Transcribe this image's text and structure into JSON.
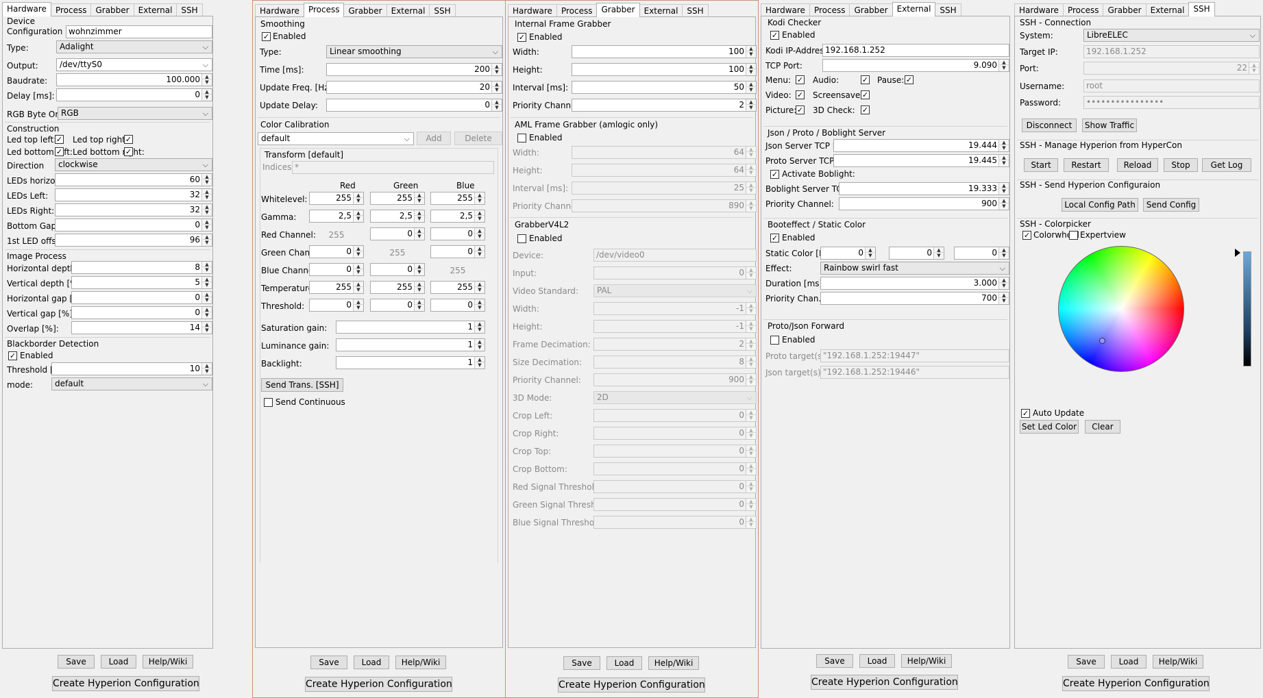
{
  "common": {
    "tabs": [
      "Hardware",
      "Process",
      "Grabber",
      "External",
      "SSH"
    ],
    "save": "Save",
    "load": "Load",
    "help": "Help/Wiki",
    "create": "Create Hyperion Configuration"
  },
  "hw": {
    "device_title": "Device",
    "config_name_label": "Configuration name:",
    "config_name": "wohnzimmer",
    "type_label": "Type:",
    "type": "Adalight",
    "output_label": "Output:",
    "output": "/dev/ttyS0",
    "baud_label": "Baudrate:",
    "baud": "100.000",
    "delay_label": "Delay [ms]:",
    "delay": "0",
    "rgb_label": "RGB Byte Order:",
    "rgb": "RGB",
    "construction_title": "Construction",
    "led_top_left": "Led top left:",
    "led_top_right": "Led top right:",
    "led_bottom_left": "Led bottom left:",
    "led_bottom_right": "Led bottom right:",
    "direction_label": "Direction",
    "direction": "clockwise",
    "leds_h_label": "LEDs horizontal:",
    "leds_h": "60",
    "leds_l_label": "LEDs Left:",
    "leds_l": "32",
    "leds_r_label": "LEDs Right:",
    "leds_r": "32",
    "bottom_gap_label": "Bottom Gap:",
    "bottom_gap": "0",
    "first_led_label": "1st LED offset",
    "first_led": "96",
    "image_title": "Image Process",
    "hdepth_label": "Horizontal depth [%]:",
    "hdepth": "8",
    "vdepth_label": "Vertical depth [%]:",
    "vdepth": "5",
    "hgap_label": "Horizontal gap [%]:",
    "hgap": "0",
    "vgap_label": "Vertical gap [%]:",
    "vgap": "0",
    "overlap_label": "Overlap [%]:",
    "overlap": "14",
    "bb_title": "Blackborder Detection",
    "enabled": "Enabled",
    "threshold_label": "Threshold [%]:",
    "threshold": "10",
    "mode_label": "mode:",
    "mode": "default"
  },
  "proc": {
    "smoothing_title": "Smoothing",
    "enabled": "Enabled",
    "type_label": "Type:",
    "type": "Linear smoothing",
    "time_label": "Time [ms]:",
    "time": "200",
    "freq_label": "Update Freq. [Hz]:",
    "freq": "20",
    "delay_label": "Update Delay:",
    "delay": "0",
    "color_title": "Color Calibration",
    "profile": "default",
    "add": "Add",
    "delete": "Delete",
    "transform_title": "Transform [default]",
    "indices_label": "Indices:",
    "indices": "*",
    "col_red": "Red",
    "col_green": "Green",
    "col_blue": "Blue",
    "rows": [
      {
        "label": "Whitelevel:",
        "r": "255",
        "g": "255",
        "b": "255"
      },
      {
        "label": "Gamma:",
        "r": "2,5",
        "g": "2,5",
        "b": "2,5"
      },
      {
        "label": "Red Channel:",
        "r": "255",
        "g": "0",
        "b": "0"
      },
      {
        "label": "Green Channel:",
        "r": "0",
        "g": "255",
        "b": "0"
      },
      {
        "label": "Blue Channel:",
        "r": "0",
        "g": "0",
        "b": "255"
      },
      {
        "label": "Temperature:",
        "r": "255",
        "g": "255",
        "b": "255"
      },
      {
        "label": "Threshold:",
        "r": "0",
        "g": "0",
        "b": "0"
      }
    ],
    "sat_label": "Saturation gain:",
    "sat": "1",
    "lum_label": "Luminance gain:",
    "lum": "1",
    "back_label": "Backlight:",
    "back": "1",
    "send_trans": "Send Trans. [SSH]",
    "send_cont": "Send Continuous"
  },
  "grab": {
    "int_title": "Internal Frame Grabber",
    "enabled": "Enabled",
    "width_label": "Width:",
    "width": "100",
    "height_label": "Height:",
    "height": "100",
    "interval_label": "Interval [ms]:",
    "interval": "50",
    "prio_label": "Priority Channel:",
    "prio": "2",
    "aml_title": "AML Frame Grabber (amlogic only)",
    "aml_width": "64",
    "aml_height": "64",
    "aml_interval": "25",
    "aml_prio": "890",
    "v4l_title": "GrabberV4L2",
    "device_label": "Device:",
    "device": "/dev/video0",
    "input_label": "Input:",
    "input": "0",
    "std_label": "Video Standard:",
    "std": "PAL",
    "v_width": "-1",
    "v_height": "-1",
    "frame_dec_label": "Frame Decimation:",
    "frame_dec": "2",
    "size_dec_label": "Size Decimation:",
    "size_dec": "8",
    "v_prio": "900",
    "mode3d_label": "3D Mode:",
    "mode3d": "2D",
    "crop_left_label": "Crop Left:",
    "crop_right_label": "Crop Right:",
    "crop_top_label": "Crop Top:",
    "crop_bottom_label": "Crop Bottom:",
    "red_thr_label": "Red Signal Threshold:",
    "green_thr_label": "Green Signal Threshold:",
    "blue_thr_label": "Blue Signal Threshold:",
    "zero": "0"
  },
  "ext": {
    "kodi_title": "Kodi Checker",
    "enabled": "Enabled",
    "ip_label": "Kodi IP-Address:",
    "ip": "192.168.1.252",
    "port_label": "TCP Port:",
    "port": "9.090",
    "menu": "Menu:",
    "audio": "Audio:",
    "pause": "Pause:",
    "video": "Video:",
    "screensaver": "Screensaver:",
    "picture": "Picture:",
    "check3d": "3D Check:",
    "server_title": "Json / Proto / Boblight Server",
    "json_label": "Json Server TCP Port:",
    "json": "19.444",
    "proto_label": "Proto Server TCP Port:",
    "proto": "19.445",
    "boblight_act": "Activate Boblight:",
    "boblight_label": "Boblight Server TCP Port:",
    "boblight": "19.333",
    "prio_label": "Priority Channel:",
    "prio": "900",
    "boot_title": "Booteffect / Static Color",
    "static_label": "Static Color [RGB]:",
    "static_r": "0",
    "static_g": "0",
    "static_b": "0",
    "effect_label": "Effect:",
    "effect": "Rainbow swirl fast",
    "duration_label": "Duration [ms]:",
    "duration": "3.000",
    "prio_chan_label": "Priority Chan.:",
    "prio_chan": "700",
    "fwd_title": "Proto/Json Forward",
    "proto_target_label": "Proto target(s):",
    "proto_target": "\"192.168.1.252:19447\"",
    "json_target_label": "Json target(s):",
    "json_target": "\"192.168.1.252:19446\""
  },
  "ssh": {
    "conn_title": "SSH - Connection",
    "system_label": "System:",
    "system": "LibreELEC",
    "target_label": "Target IP:",
    "target": "192.168.1.252",
    "port_label": "Port:",
    "port": "22",
    "user_label": "Username:",
    "user": "root",
    "pass_label": "Password:",
    "pass": "••••••••••••••••",
    "disconnect": "Disconnect",
    "traffic": "Show Traffic",
    "manage_title": "SSH - Manage Hyperion from HyperCon",
    "start": "Start",
    "restart": "Restart",
    "reload": "Reload",
    "stop": "Stop",
    "getlog": "Get Log",
    "send_title": "SSH - Send Hyperion Configuraion",
    "local_path": "Local Config Path",
    "send_config": "Send Config",
    "picker_title": "SSH - Colorpicker",
    "colorwheel": "Colorwheel",
    "expertview": "Expertview",
    "auto_update": "Auto Update",
    "set_led": "Set Led Color",
    "clear": "Clear"
  }
}
